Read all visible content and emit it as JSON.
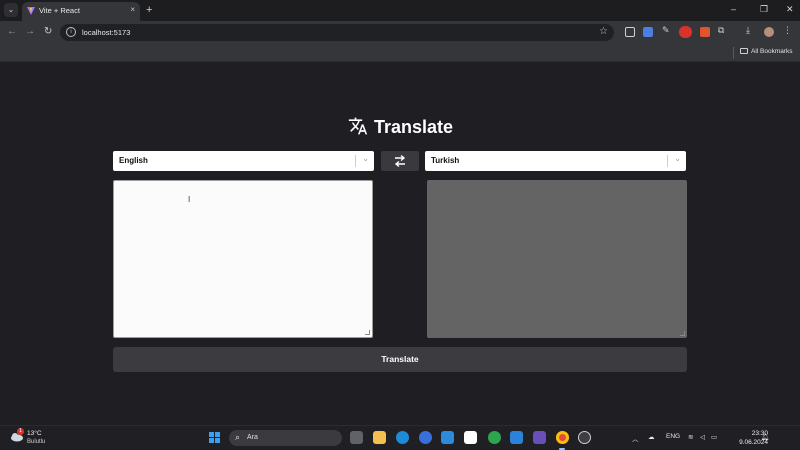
{
  "browser": {
    "tab_title": "Vite + React",
    "tab_close": "×",
    "new_tab": "+",
    "url": "localhost:5173",
    "bookmarks_label": "All Bookmarks",
    "window_controls": {
      "minimize": "–",
      "restore": "❐",
      "close": "✕"
    }
  },
  "app": {
    "heading": "Translate",
    "source_language": "English",
    "target_language": "Turkish",
    "source_text": "",
    "translated_text": "",
    "translate_button": "Translate"
  },
  "taskbar": {
    "weather_temp": "13°C",
    "weather_condition": "Bulutlu",
    "weather_badge": "1",
    "search_placeholder": "Ara",
    "language": "ENG",
    "time": "23:30",
    "date": "9.06.2024"
  },
  "colors": {
    "page_background": "#1f1f23",
    "select_background": "#ffffff",
    "target_textarea": "#646464",
    "button": "#3c3c40"
  }
}
